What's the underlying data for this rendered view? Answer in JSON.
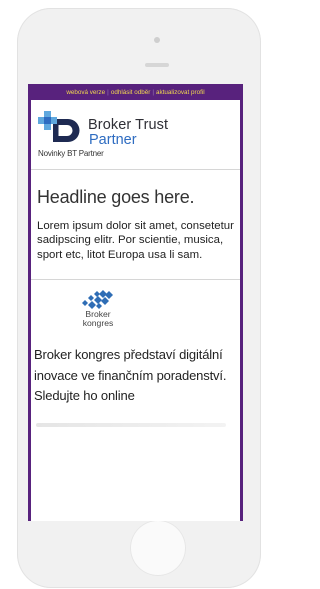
{
  "topbar": {
    "web_version": "webová verze",
    "unsubscribe": "odhlásit odběr",
    "update_profile": "aktualizovat profil",
    "separator": "|"
  },
  "brand": {
    "name": "Broker Trust",
    "sub": "Partner",
    "newsletter": "Novinky BT Partner",
    "colors": {
      "navy": "#1e2a52",
      "blue": "#2e6cc1",
      "light_blue": "#5fa8de"
    }
  },
  "article1": {
    "headline": "Headline goes here.",
    "body": "Lorem ipsum dolor sit amet, consetetur sadipscing elitr. Por scientie, musica, sport etc, litot Europa usa li sam."
  },
  "kongres": {
    "line1": "Broker",
    "line2": "kongres",
    "color": "#2f6db5"
  },
  "article2": {
    "text": "Broker kongres představí digitální inovace ve finančním poradenství. Sledujte ho online"
  },
  "colors": {
    "frame_purple": "#58227d",
    "link_yellow": "#f1d84f"
  }
}
